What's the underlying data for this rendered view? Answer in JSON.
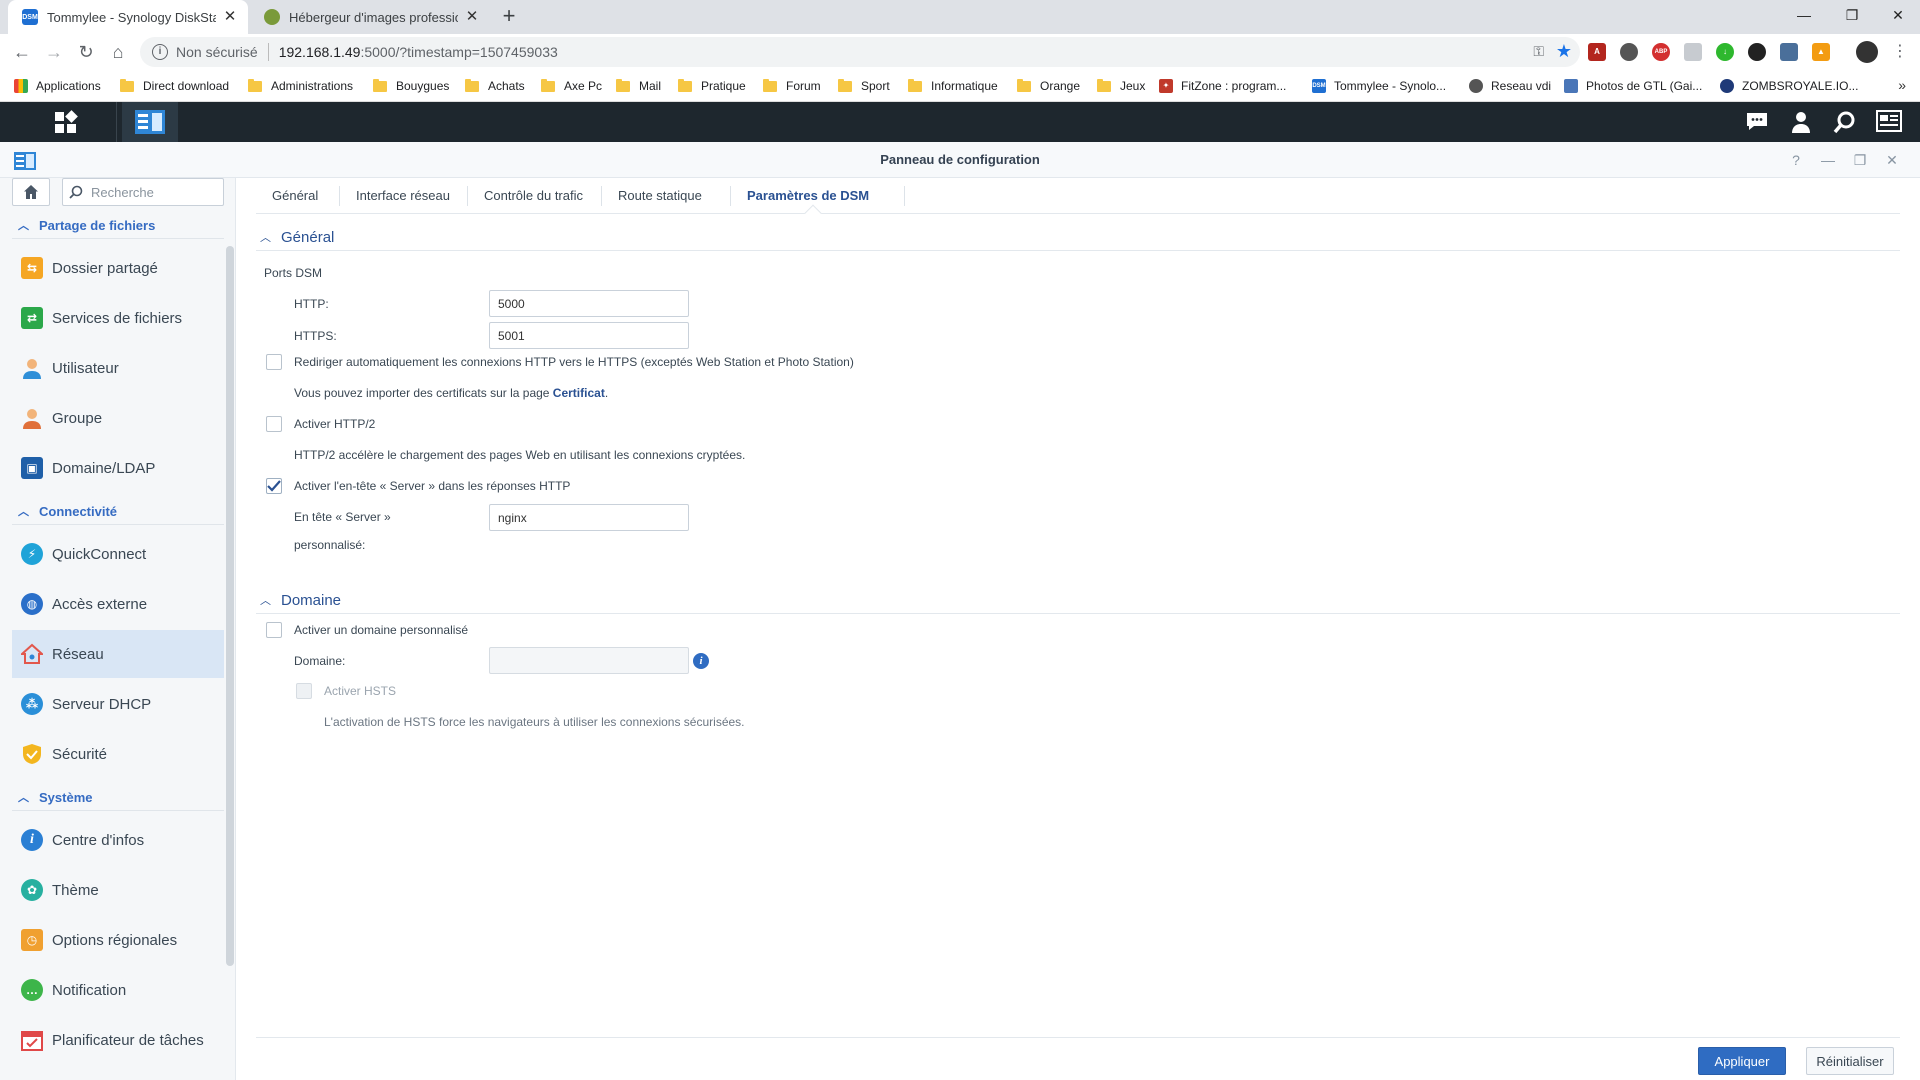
{
  "browser": {
    "tabs": [
      {
        "title": "Tommylee - Synology DiskStation",
        "favicon": "DSM"
      },
      {
        "title": "Hébergeur d'images professionnel",
        "favicon": ""
      }
    ],
    "new_tab": "+",
    "window_controls": {
      "minimize": "—",
      "restore": "❐",
      "close": "✕"
    },
    "address": {
      "security_label": "Non sécurisé",
      "host": "192.168.1.49",
      "path": ":5000/?timestamp=1507459033"
    },
    "bookmarks": [
      {
        "label": "Applications",
        "icon": "apps-grid-icon"
      },
      {
        "label": "Direct download",
        "icon": "folder-icon"
      },
      {
        "label": "Administrations",
        "icon": "folder-icon"
      },
      {
        "label": "Bouygues",
        "icon": "folder-icon"
      },
      {
        "label": "Achats",
        "icon": "folder-icon"
      },
      {
        "label": "Axe Pc",
        "icon": "folder-icon"
      },
      {
        "label": "Mail",
        "icon": "folder-icon"
      },
      {
        "label": "Pratique",
        "icon": "folder-icon"
      },
      {
        "label": "Forum",
        "icon": "folder-icon"
      },
      {
        "label": "Sport",
        "icon": "folder-icon"
      },
      {
        "label": "Informatique",
        "icon": "folder-icon"
      },
      {
        "label": "Orange",
        "icon": "folder-icon"
      },
      {
        "label": "Jeux",
        "icon": "folder-icon"
      },
      {
        "label": "FitZone : program...",
        "icon": "fitzone-icon"
      },
      {
        "label": "Tommylee - Synolo...",
        "icon": "dsm-icon"
      },
      {
        "label": "Reseau vdi",
        "icon": "globe-icon"
      },
      {
        "label": "Photos de GTL (Gai...",
        "icon": "photos-icon"
      },
      {
        "label": "ZOMBSROYALE.IO...",
        "icon": "zombs-icon"
      }
    ],
    "bookmarks_more": "»"
  },
  "window": {
    "title": "Panneau de configuration",
    "controls": {
      "help": "?",
      "minimize": "—",
      "maximize": "❐",
      "close": "✕"
    }
  },
  "sidebar": {
    "search_placeholder": "Recherche",
    "groups": [
      {
        "label": "Partage de fichiers",
        "items": [
          {
            "label": "Dossier partagé",
            "icon": "shared-folder-icon",
            "color": "#f5a623"
          },
          {
            "label": "Services de fichiers",
            "icon": "file-services-icon",
            "color": "#2ba84a"
          },
          {
            "label": "Utilisateur",
            "icon": "user-icon",
            "color": "#2f8fd8"
          },
          {
            "label": "Groupe",
            "icon": "group-icon",
            "color": "#e0703a"
          },
          {
            "label": "Domaine/LDAP",
            "icon": "domain-ldap-icon",
            "color": "#1f5fa8"
          }
        ]
      },
      {
        "label": "Connectivité",
        "items": [
          {
            "label": "QuickConnect",
            "icon": "quickconnect-icon",
            "color": "#1fa3d8"
          },
          {
            "label": "Accès externe",
            "icon": "external-access-icon",
            "color": "#2a6fc9"
          },
          {
            "label": "Réseau",
            "icon": "network-icon",
            "color": "#e2574c"
          },
          {
            "label": "Serveur DHCP",
            "icon": "dhcp-server-icon",
            "color": "#2a8fd8"
          },
          {
            "label": "Sécurité",
            "icon": "security-icon",
            "color": "#f3b61f"
          }
        ]
      },
      {
        "label": "Système",
        "items": [
          {
            "label": "Centre d'infos",
            "icon": "info-center-icon",
            "color": "#2a7fd4"
          },
          {
            "label": "Thème",
            "icon": "theme-icon",
            "color": "#27b0a0"
          },
          {
            "label": "Options régionales",
            "icon": "regional-options-icon",
            "color": "#f0a030"
          },
          {
            "label": "Notification",
            "icon": "notification-icon",
            "color": "#3db54a"
          },
          {
            "label": "Planificateur de tâches",
            "icon": "task-scheduler-icon",
            "color": "#e04848"
          }
        ]
      }
    ],
    "selected": "Réseau"
  },
  "content": {
    "tabs": [
      "Général",
      "Interface réseau",
      "Contrôle du trafic",
      "Route statique",
      "Paramètres de DSM"
    ],
    "active_tab": "Paramètres de DSM",
    "general": {
      "heading": "Général",
      "ports_label": "Ports DSM",
      "http_label": "HTTP:",
      "http_value": "5000",
      "https_label": "HTTPS:",
      "https_value": "5001",
      "redirect_label": "Rediriger automatiquement les connexions HTTP vers le HTTPS (exceptés Web Station et Photo Station)",
      "redirect_checked": false,
      "cert_note_prefix": "Vous pouvez importer des certificats sur la page ",
      "cert_link": "Certificat",
      "cert_note_suffix": ".",
      "http2_label": "Activer HTTP/2",
      "http2_checked": false,
      "http2_note": "HTTP/2 accélère le chargement des pages Web en utilisant les connexions cryptées.",
      "server_header_label": "Activer l'en-tête « Server » dans les réponses HTTP",
      "server_header_checked": true,
      "custom_header_label_1": "En tête « Server »",
      "custom_header_label_2": "personnalisé:",
      "custom_header_value": "nginx"
    },
    "domain": {
      "heading": "Domaine",
      "custom_domain_label": "Activer un domaine personnalisé",
      "custom_domain_checked": false,
      "domain_label": "Domaine:",
      "domain_value": "",
      "hsts_label": "Activer HSTS",
      "hsts_note": "L'activation de HSTS force les navigateurs à utiliser les connexions sécurisées."
    },
    "buttons": {
      "apply": "Appliquer",
      "reset": "Réinitialiser"
    }
  },
  "colors": {
    "accent": "#2f6cc2",
    "taskbar": "#1e272e",
    "selected_nav": "#d9e6f5"
  }
}
